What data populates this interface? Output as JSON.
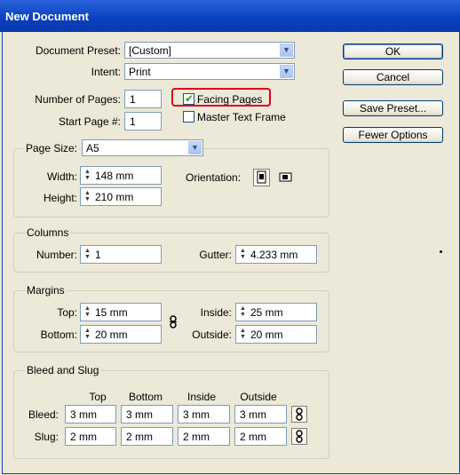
{
  "window": {
    "title": "New Document"
  },
  "preset": {
    "label": "Document Preset:",
    "value": "[Custom]"
  },
  "intent": {
    "label": "Intent:",
    "value": "Print"
  },
  "pages": {
    "num_label": "Number of Pages:",
    "num_value": "1",
    "start_label": "Start Page #:",
    "start_value": "1",
    "facing_label": "Facing Pages",
    "facing_checked": true,
    "master_label": "Master Text Frame",
    "master_checked": false
  },
  "page_size": {
    "label": "Page Size:",
    "value": "A5",
    "width_label": "Width:",
    "width_value": "148 mm",
    "height_label": "Height:",
    "height_value": "210 mm",
    "orientation_label": "Orientation:"
  },
  "columns": {
    "title": "Columns",
    "number_label": "Number:",
    "number_value": "1",
    "gutter_label": "Gutter:",
    "gutter_value": "4.233 mm"
  },
  "margins": {
    "title": "Margins",
    "top_label": "Top:",
    "top_value": "15 mm",
    "bottom_label": "Bottom:",
    "bottom_value": "20 mm",
    "inside_label": "Inside:",
    "inside_value": "25 mm",
    "outside_label": "Outside:",
    "outside_value": "20 mm"
  },
  "bleed_slug": {
    "title": "Bleed and Slug",
    "headers": [
      "Top",
      "Bottom",
      "Inside",
      "Outside"
    ],
    "bleed_label": "Bleed:",
    "bleed": [
      "3 mm",
      "3 mm",
      "3 mm",
      "3 mm"
    ],
    "slug_label": "Slug:",
    "slug": [
      "2 mm",
      "2 mm",
      "2 mm",
      "2 mm"
    ]
  },
  "buttons": {
    "ok": "OK",
    "cancel": "Cancel",
    "save_preset": "Save Preset...",
    "fewer_options": "Fewer Options"
  },
  "icons": {
    "portrait": "portrait-orientation-icon",
    "landscape": "landscape-orientation-icon",
    "chain": "chain-link-icon"
  }
}
